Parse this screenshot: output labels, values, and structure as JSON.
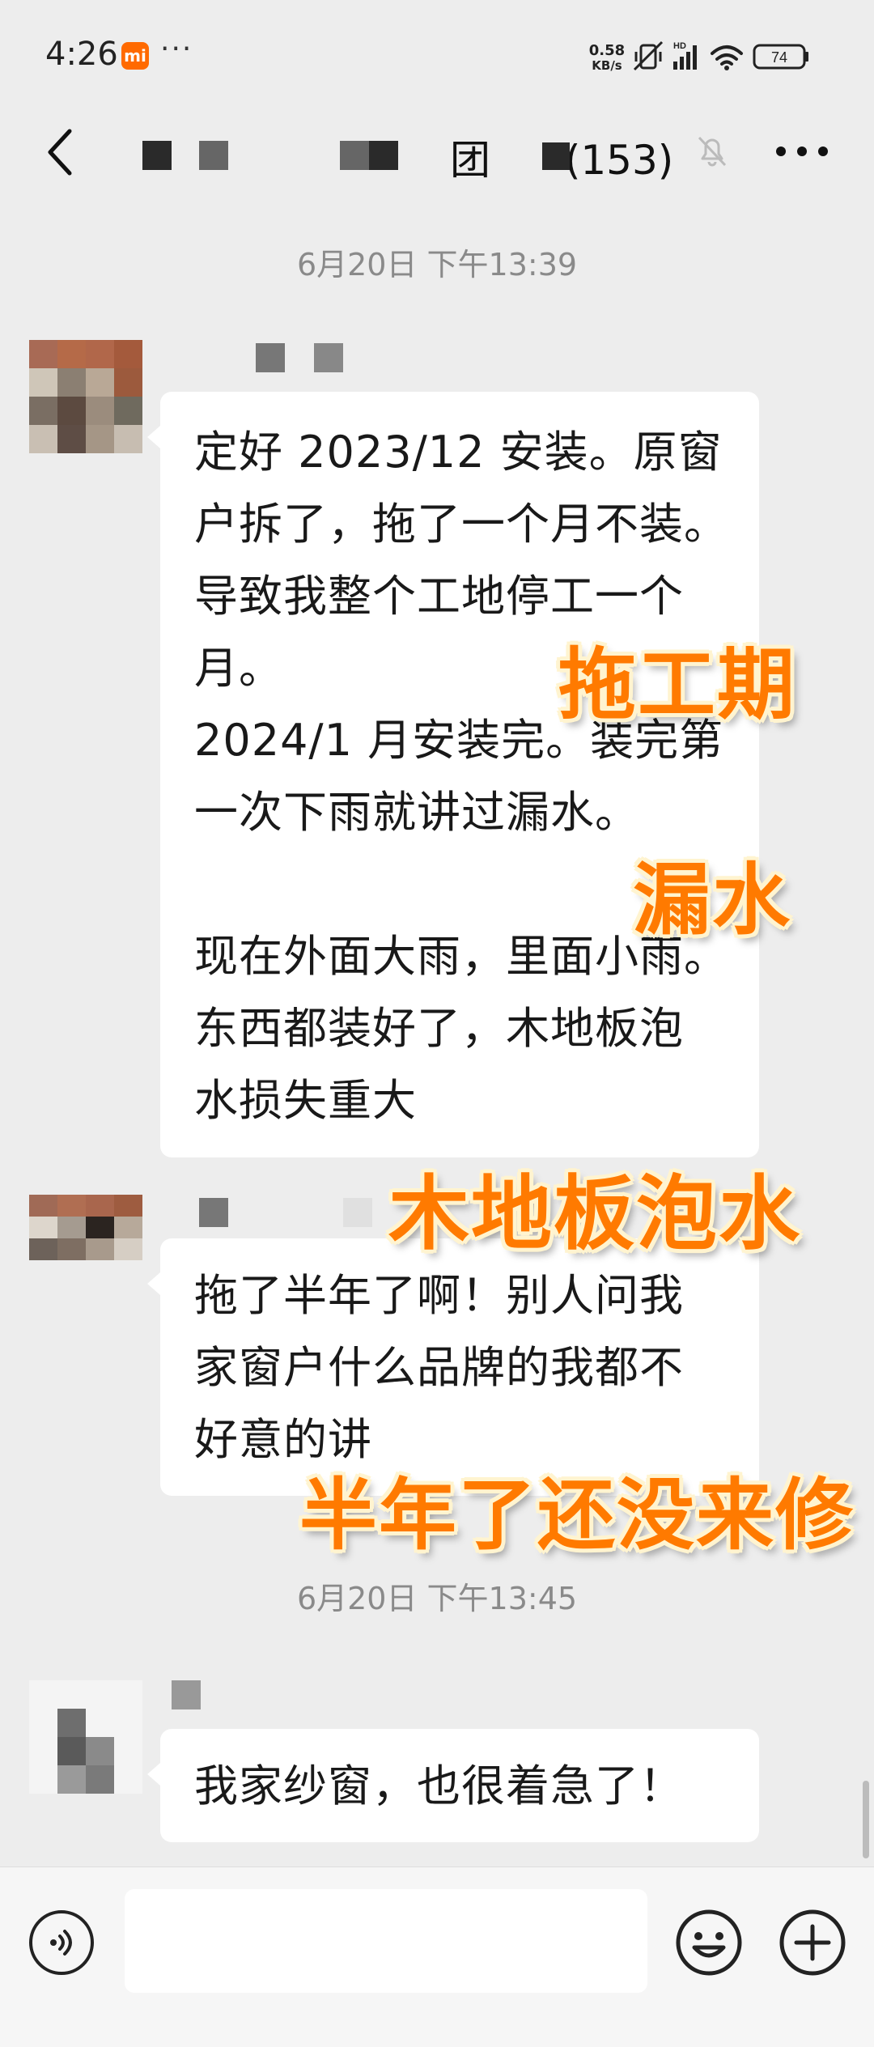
{
  "status_bar": {
    "time": "4:26",
    "mi_badge": "mi",
    "dots": "···",
    "net_speed": "0.58",
    "net_unit": "KB/s",
    "hd": "HD",
    "battery": "74"
  },
  "header": {
    "title_visible": "团",
    "member_count": "(153)"
  },
  "messages": {
    "timestamp_1": "6月20日 下午13:39",
    "msg_1": "定好 2023/12 安装。原窗\n户拆了，拖了一个月不装。\n导致我整个工地停工一个\n月。\n2024/1 月安装完。装完第\n一次下雨就讲过漏水。\n\n现在外面大雨，里面小雨。\n东西都装好了，木地板泡\n水损失重大",
    "msg_2": "拖了半年了啊！别人问我\n家窗户什么品牌的我都不\n好意的讲",
    "timestamp_2": "6月20日 下午13:45",
    "msg_3": "我家纱窗，也很着急了！"
  },
  "overlays": {
    "caption_1": "拖工期",
    "caption_2": "漏水",
    "caption_3": "木地板泡水",
    "caption_4": "半年了还没来修"
  },
  "colors": {
    "background": "#ededed",
    "bubble": "#ffffff",
    "overlay_text": "#ff7a00",
    "mi_badge": "#ff6a00"
  },
  "icons": [
    "back-icon",
    "mute-icon",
    "more-icon",
    "voice-icon",
    "emoji-icon",
    "plus-icon",
    "wifi-icon",
    "signal-icon",
    "battery-icon"
  ]
}
